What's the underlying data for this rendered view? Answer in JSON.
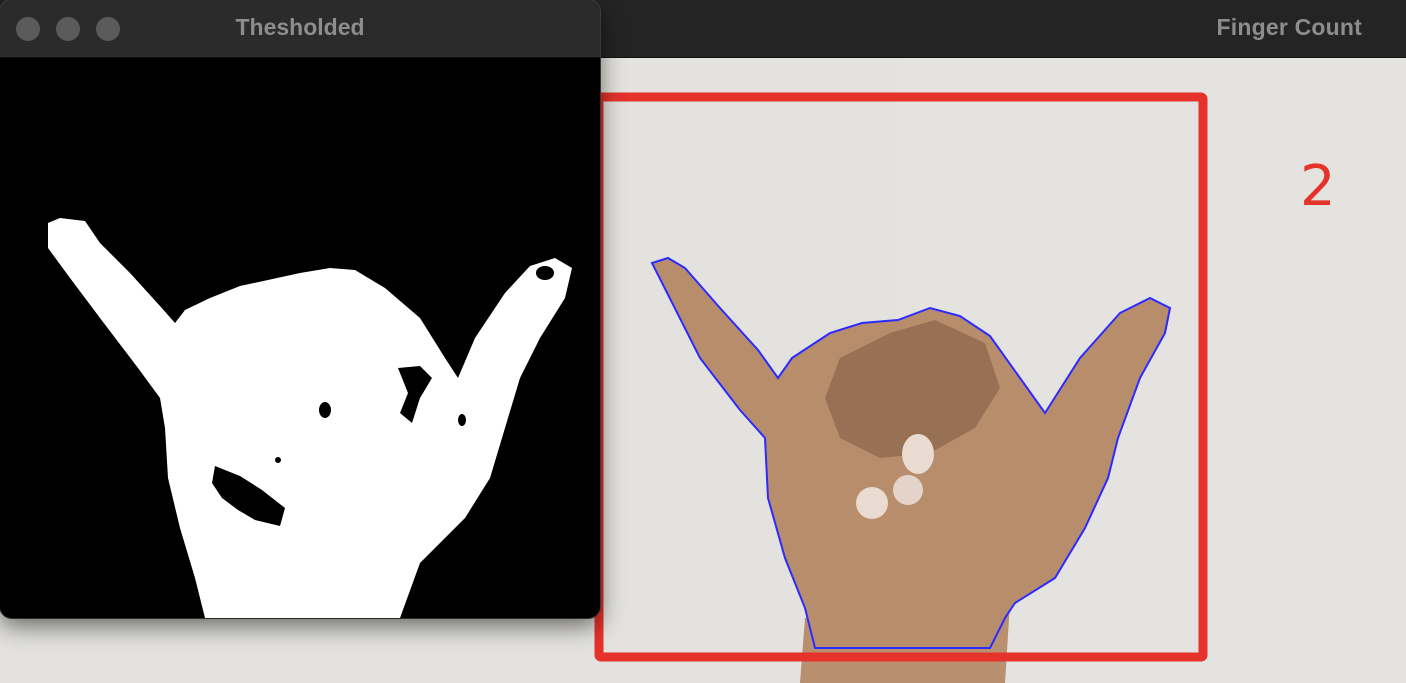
{
  "finger_window": {
    "title": "Finger Count",
    "count_label": "2",
    "roi_color": "#e5322b",
    "contour_color": "#2b2bff"
  },
  "threshold_window": {
    "title": "Thesholded",
    "traffic_lights": [
      "close-button",
      "minimize-button",
      "zoom-button"
    ]
  }
}
